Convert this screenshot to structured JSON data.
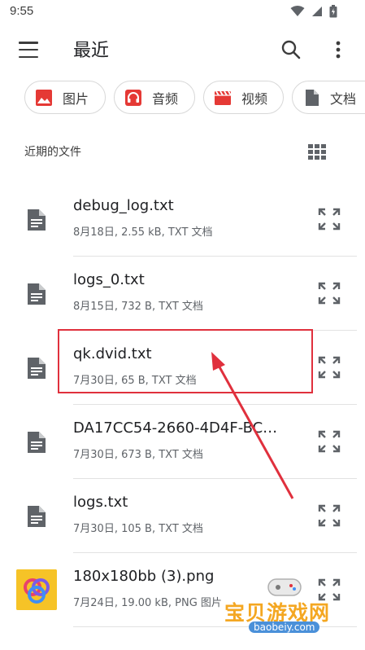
{
  "status": {
    "time": "9:55"
  },
  "app_bar": {
    "title": "最近",
    "icons": [
      "menu-icon",
      "search-icon",
      "more-vert-icon"
    ]
  },
  "chips": [
    {
      "label": "图片",
      "icon": "image-icon",
      "color": "#e53935"
    },
    {
      "label": "音频",
      "icon": "headphones-icon",
      "color": "#e53935"
    },
    {
      "label": "视频",
      "icon": "movie-icon",
      "color": "#e53935"
    },
    {
      "label": "文档",
      "icon": "document-icon",
      "color": "#5f6368"
    }
  ],
  "section": {
    "title": "近期的文件",
    "view_icon": "grid-view-icon"
  },
  "files": [
    {
      "name": "debug_log.txt",
      "meta": "8月18日, 2.55 kB, TXT 文档",
      "icon": "text-file-icon"
    },
    {
      "name": "logs_0.txt",
      "meta": "8月15日, 732 B, TXT 文档",
      "icon": "text-file-icon"
    },
    {
      "name": "qk.dvid.txt",
      "meta": "7月30日, 65 B, TXT 文档",
      "icon": "text-file-icon"
    },
    {
      "name": "DA17CC54-2660-4D4F-BC…",
      "meta": "7月30日, 673 B, TXT 文档",
      "icon": "text-file-icon"
    },
    {
      "name": "logs.txt",
      "meta": "7月30日, 105 B, TXT 文档",
      "icon": "text-file-icon"
    },
    {
      "name": "180x180bb (3).png",
      "meta": "7月24日, 19.00 kB, PNG 图片",
      "icon": "image-thumbnail"
    }
  ],
  "annotation": {
    "highlight_color": "#e0303d"
  },
  "watermark": {
    "text": "宝贝游戏网",
    "url": "baobeiy.com"
  }
}
